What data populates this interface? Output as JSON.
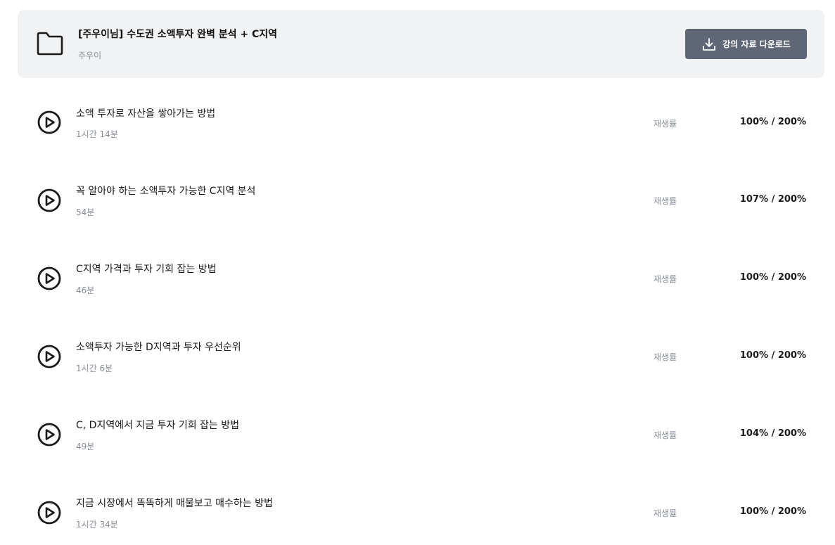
{
  "course": {
    "title": "[주우이님] 수도권 소액투자 완벽 분석 + C지역",
    "author": "주우이",
    "folder_icon": "folder-icon",
    "download_label": "강의 자료 다운로드",
    "download_icon": "download-icon"
  },
  "lectures": [
    {
      "title": "소액 투자로 자산을 쌓아가는 방법",
      "duration": "1시간 14분",
      "rate_label": "재생률",
      "rate": "100% / 200%",
      "icon": "play-circle-icon"
    },
    {
      "title": "꼭 알아야 하는 소액투자 가능한 C지역 분석",
      "duration": "54분",
      "rate_label": "재생률",
      "rate": "107% / 200%",
      "icon": "play-circle-icon"
    },
    {
      "title": "C지역 가격과 투자 기회 잡는 방법",
      "duration": "46분",
      "rate_label": "재생률",
      "rate": "100% / 200%",
      "icon": "play-circle-icon"
    },
    {
      "title": "소액투자 가능한 D지역과 투자 우선순위",
      "duration": "1시간 6분",
      "rate_label": "재생률",
      "rate": "100% / 200%",
      "icon": "play-circle-icon"
    },
    {
      "title": "C, D지역에서 지금 투자 기회 잡는 방법",
      "duration": "49분",
      "rate_label": "재생률",
      "rate": "104% / 200%",
      "icon": "play-circle-icon"
    },
    {
      "title": "지금 시장에서 똑똑하게 매물보고 매수하는 방법",
      "duration": "1시간 34분",
      "rate_label": "재생률",
      "rate": "100% / 200%",
      "icon": "play-circle-icon"
    }
  ]
}
